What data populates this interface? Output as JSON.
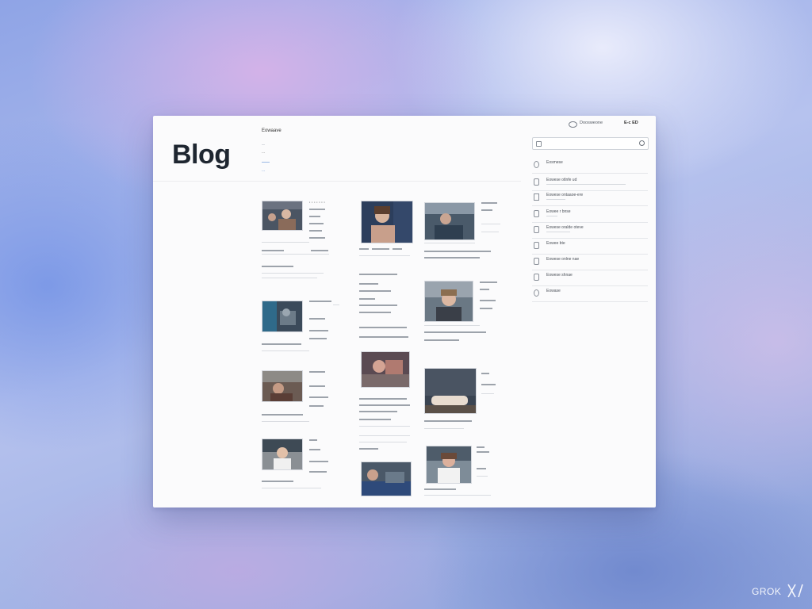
{
  "header": {
    "title": "Blog",
    "site_name": "Eowaave",
    "tagline": "...",
    "breadcrumb": "..."
  },
  "topbar": {
    "link1": "Doosweone",
    "link2": "E-c ED"
  },
  "sidebar": {
    "items": [
      {
        "label": "Eosmese",
        "icon": "circle-icon"
      },
      {
        "label": "Eowese otlnfe ud",
        "icon": "phone-icon"
      },
      {
        "label": "Eowese ontaaoe-ere",
        "icon": "document-icon"
      },
      {
        "label": "Eowee r bnse",
        "icon": "pin-icon"
      },
      {
        "label": "Eowese oralde oteve",
        "icon": "list-icon"
      },
      {
        "label": "Eowee bte",
        "icon": "question-icon"
      },
      {
        "label": "Eowese onlne nae",
        "icon": "gear-icon"
      },
      {
        "label": "Eowese shnae",
        "icon": "user-icon"
      },
      {
        "label": "Eowase",
        "icon": "info-icon"
      }
    ]
  },
  "colors": {
    "accent": "#4a7fd0",
    "title": "#1e2630"
  }
}
